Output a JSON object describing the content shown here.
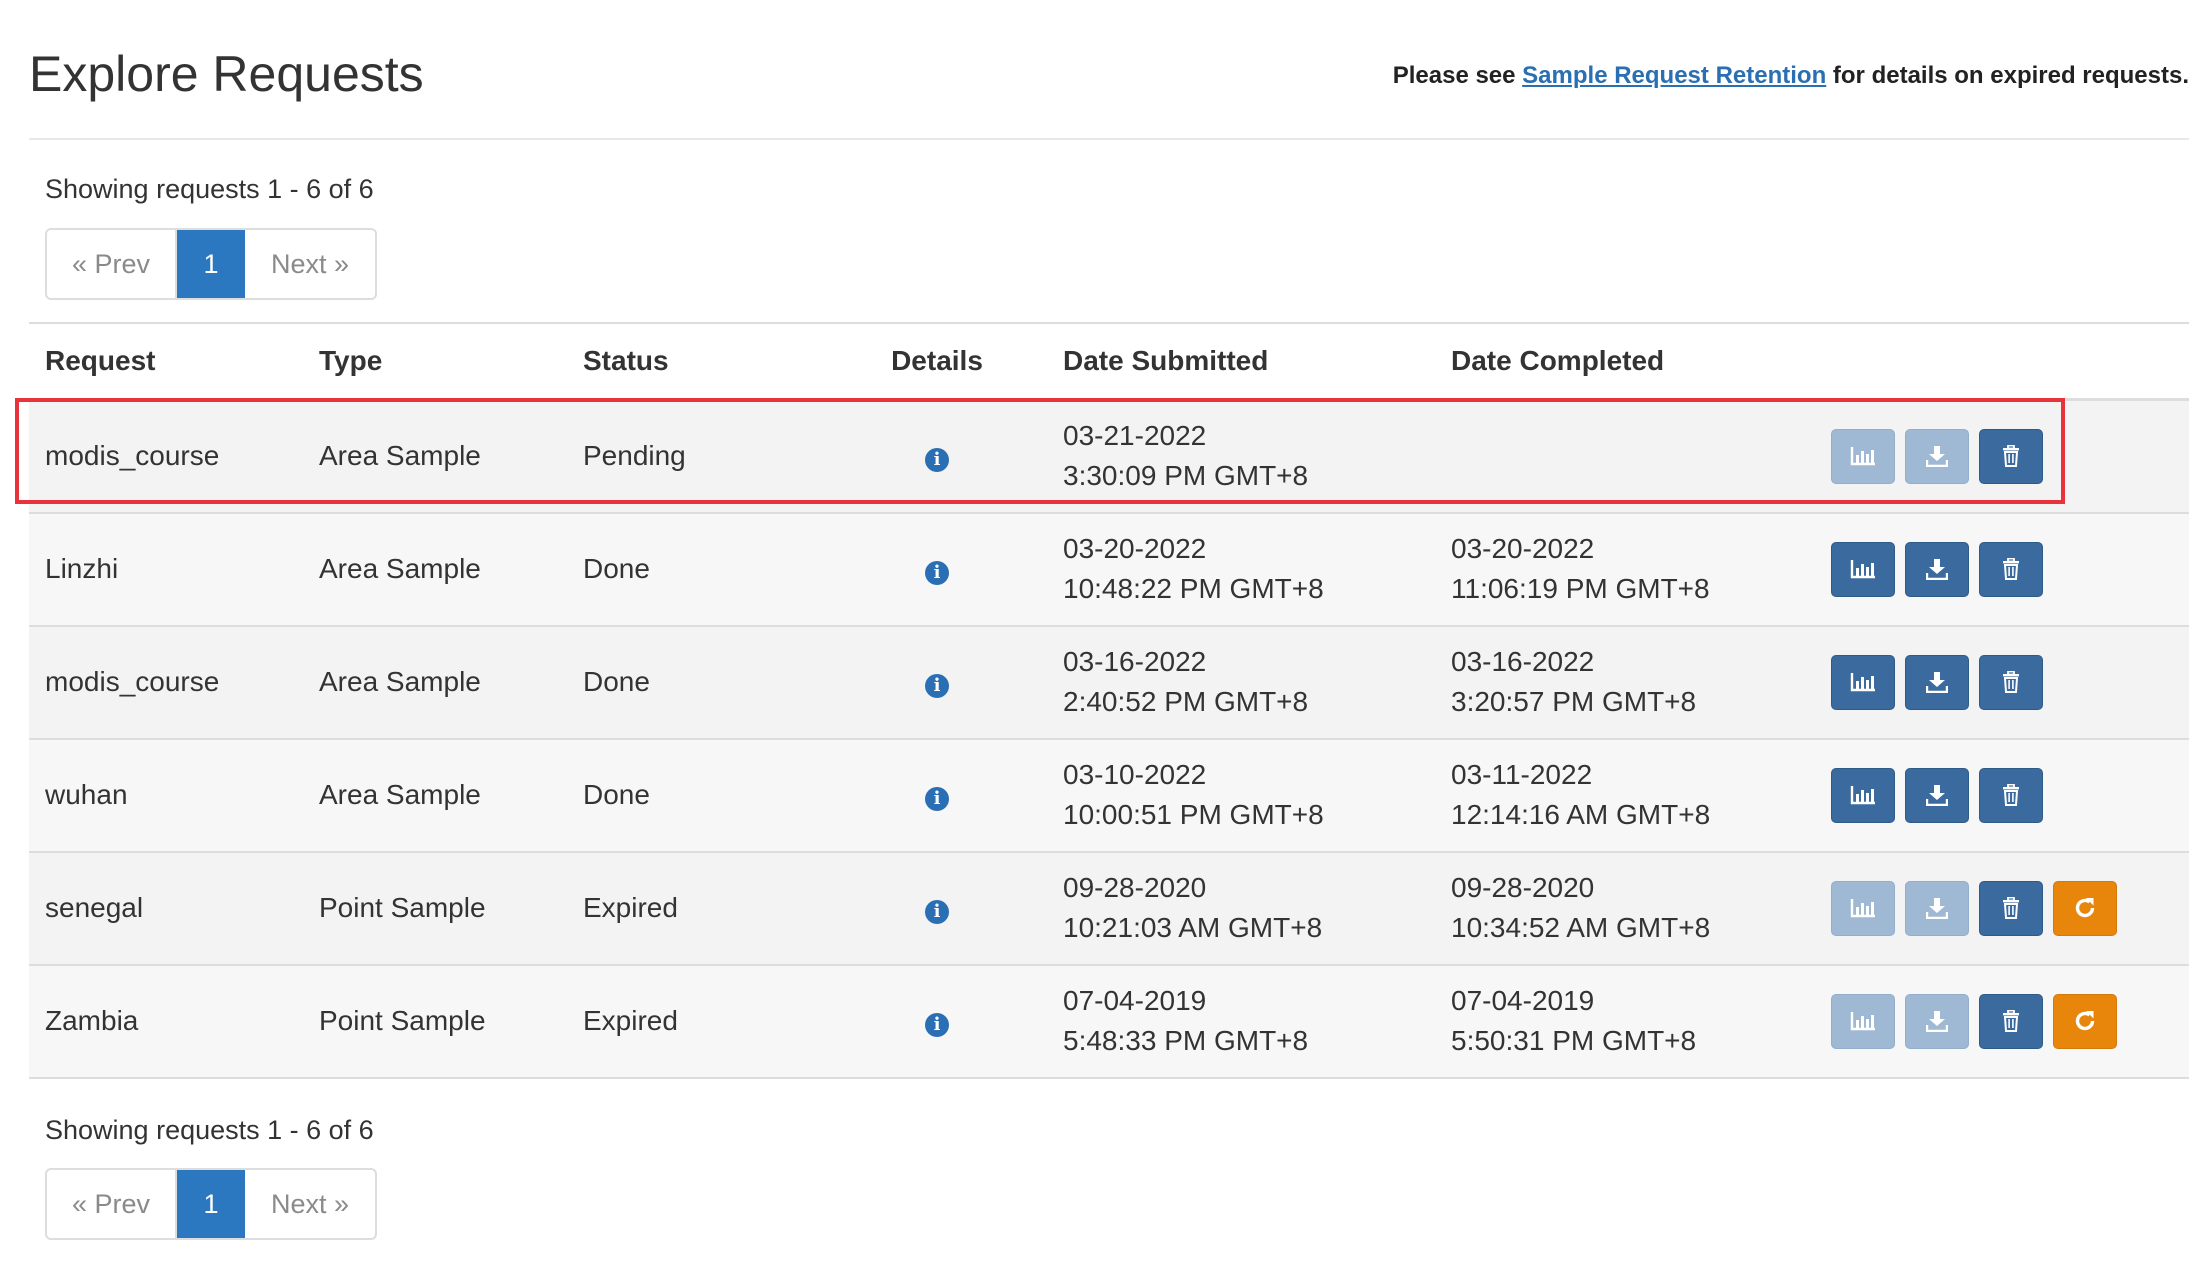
{
  "header": {
    "title": "Explore Requests",
    "note_prefix": "Please see ",
    "note_link": "Sample Request Retention",
    "note_suffix": " for details on expired requests."
  },
  "pagination_top": {
    "showing": "Showing requests 1 - 6 of 6",
    "prev": "« Prev",
    "page": "1",
    "next": "Next »"
  },
  "pagination_bottom": {
    "showing": "Showing requests 1 - 6 of 6",
    "prev": "« Prev",
    "page": "1",
    "next": "Next »"
  },
  "table": {
    "headers": {
      "request": "Request",
      "type": "Type",
      "status": "Status",
      "details": "Details",
      "date_submitted": "Date Submitted",
      "date_completed": "Date Completed"
    },
    "rows": [
      {
        "request": "modis_course",
        "type": "Area Sample",
        "status": "Pending",
        "submitted_date": "03-21-2022",
        "submitted_time": "3:30:09 PM GMT+8",
        "completed_date": "",
        "completed_time": ""
      },
      {
        "request": "Linzhi",
        "type": "Area Sample",
        "status": "Done",
        "submitted_date": "03-20-2022",
        "submitted_time": "10:48:22 PM GMT+8",
        "completed_date": "03-20-2022",
        "completed_time": "11:06:19 PM GMT+8"
      },
      {
        "request": "modis_course",
        "type": "Area Sample",
        "status": "Done",
        "submitted_date": "03-16-2022",
        "submitted_time": "2:40:52 PM GMT+8",
        "completed_date": "03-16-2022",
        "completed_time": "3:20:57 PM GMT+8"
      },
      {
        "request": "wuhan",
        "type": "Area Sample",
        "status": "Done",
        "submitted_date": "03-10-2022",
        "submitted_time": "10:00:51 PM GMT+8",
        "completed_date": "03-11-2022",
        "completed_time": "12:14:16 AM GMT+8"
      },
      {
        "request": "senegal",
        "type": "Point Sample",
        "status": "Expired",
        "submitted_date": "09-28-2020",
        "submitted_time": "10:21:03 AM GMT+8",
        "completed_date": "09-28-2020",
        "completed_time": "10:34:52 AM GMT+8"
      },
      {
        "request": "Zambia",
        "type": "Point Sample",
        "status": "Expired",
        "submitted_date": "07-04-2019",
        "submitted_time": "5:48:33 PM GMT+8",
        "completed_date": "07-04-2019",
        "completed_time": "5:50:31 PM GMT+8"
      }
    ]
  },
  "icons": {
    "details": "info-icon",
    "chart": "bar-chart-icon",
    "download": "download-icon",
    "delete": "trash-icon",
    "resubmit": "refresh-icon"
  },
  "colors": {
    "link": "#2a6fb3",
    "button_active": "#3b6a9e",
    "button_disabled": "#9fb8d4",
    "button_resubmit": "#e8860c",
    "highlight": "#e8323c",
    "pager_active": "#2c78c0"
  }
}
